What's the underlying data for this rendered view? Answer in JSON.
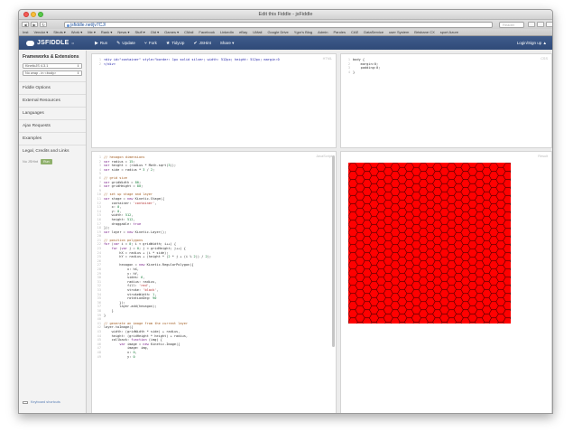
{
  "window": {
    "title": "Edit this Fiddle - jsFiddle",
    "url": "jsfiddle.net/jv7CJ/",
    "reader": "Reader"
  },
  "bookmarks": [
    "Inst",
    "Vendor ▾",
    "Struts ▾",
    "Work ▾",
    "Me ▾",
    "Rank ▾",
    "News ▾",
    "Stuff ▾",
    "Old ▾",
    "Games ▾",
    "CMail",
    "Facebook",
    "LinkedIn",
    "eBay",
    "UMail",
    "Google Drive",
    "Ygor's Blog",
    "Admin",
    "Paroles",
    "CAE",
    "DataService",
    "user System",
    "Brisbane CX",
    "sport Azure"
  ],
  "header": {
    "logo": "JSFIDDLE",
    "version": "α",
    "actions": [
      {
        "icon": "▶",
        "label": "Run"
      },
      {
        "icon": "✎",
        "label": "Update"
      },
      {
        "icon": "⑂",
        "label": "Fork"
      },
      {
        "icon": "★",
        "label": "TidyUp"
      },
      {
        "icon": "✔",
        "label": "JSHint"
      },
      {
        "icon": "",
        "label": "Share ▾"
      }
    ],
    "login": "Login/Sign up ▲"
  },
  "sidebar": {
    "heading": "Frameworks & Extensions",
    "framework": "KineticJS 4.3.1",
    "wrap": "No wrap - in <body>",
    "items": [
      "Fiddle Options",
      "External Resources",
      "Languages",
      "Ajax Requests",
      "Examples",
      "Legal, Credits and Links"
    ],
    "jshint_text": "No JSHint",
    "jshint_btn": "Run",
    "keyboard": "Keyboard shortcuts"
  },
  "panels": {
    "html_label": "HTML",
    "css_label": "CSS",
    "js_label": "JavaScript",
    "result_label": "Result"
  },
  "code": {
    "html": "<div id=\"container\" style=\"border: 1px solid silver; width: 512px; height: 512px; margin:0\n</div>",
    "css": "body {\n    margin:0;\n    padding:0;\n}",
    "js": [
      "// hexagon dimensions",
      "var radius = 15;",
      "var height = (radius * Math.sqrt(3));",
      "var side = radius * 3 / 2;",
      "",
      "// grid size",
      "var gridWidth = 80;",
      "var gridHeight = 80;",
      "",
      "// set up stage and layer",
      "var stage = new Kinetic.Stage({",
      "    container: 'container',",
      "    x: 0,",
      "    y: 0,",
      "    width: 512,",
      "    height: 512,",
      "    draggable: true",
      "});",
      "var layer = new Kinetic.Layer();",
      "",
      "// position polygons",
      "for (var i = 0; i < gridWidth; i++) {",
      "    for (var j = 0; j < gridHeight; j++) {",
      "        hX = radius + (i * side);",
      "        hY = radius + (height * (2 * j + (i % 2)) / 2);",
      "",
      "        hexagon = new Kinetic.RegularPolygon({",
      "            x: hX,",
      "            y: hY,",
      "            sides: 6,",
      "            radius: radius,",
      "            fill: 'red',",
      "            stroke: 'black',",
      "            strokeWidth: 1,",
      "            rotationDeg: 90",
      "        });",
      "        layer.add(hexagon);",
      "    }",
      "}",
      "",
      "// generate an image from the current layer",
      "layer.toImage({",
      "    width: (gridWidth * side) + radius,",
      "    height: (gridHeight * height) + radius,",
      "    callback: function (img) {",
      "        var image = new Kinetic.Image({",
      "            image: img,",
      "            x: 0,",
      "            y: 0"
    ]
  },
  "result": {
    "hex_fill": "#ff0000",
    "hex_stroke": "#000000"
  }
}
